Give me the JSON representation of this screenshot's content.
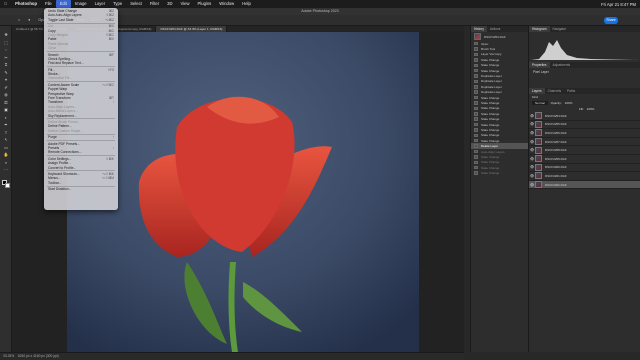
{
  "menubar": {
    "app_name": "Photoshop",
    "items": [
      "File",
      "Edit",
      "Image",
      "Layer",
      "Type",
      "Select",
      "Filter",
      "3D",
      "View",
      "Plugins",
      "Window",
      "Help"
    ],
    "active_index": 1,
    "clock": "Fri Apr 21 8:47 PM"
  },
  "window": {
    "title": "Adobe Photoshop 2023"
  },
  "options": {
    "opacity_label": "Opacity:",
    "opacity_value": "100%",
    "flow_label": "Flow:",
    "flow_value": "100%",
    "share_label": "Share"
  },
  "tabs": [
    {
      "label": "Untitled-1 @ 66.7% (Layer 1, RGB/8)"
    },
    {
      "label": "DSCF3254.RAF @ 33.3% (Background copy, RGB/16)"
    },
    {
      "label": "DSCF3254.RAF @ 33.3% (Layer 1, RGB/16)",
      "active": true
    }
  ],
  "edit_menu": {
    "rows": [
      {
        "label": "Undo State Change",
        "shortcut": "⌘Z"
      },
      {
        "label": "Auto Auto-Align Layers",
        "shortcut": "⇧⌘Z"
      },
      {
        "label": "Toggle Last State",
        "shortcut": "⌥⌘Z"
      },
      {
        "sep": true
      },
      {
        "label": "Cut",
        "shortcut": "⌘X",
        "disabled": true
      },
      {
        "label": "Copy",
        "shortcut": "⌘C"
      },
      {
        "label": "Copy Merged",
        "shortcut": "⇧⌘C",
        "disabled": true
      },
      {
        "label": "Paste",
        "shortcut": "⌘V"
      },
      {
        "label": "Paste Special",
        "shortcut": "",
        "disabled": true
      },
      {
        "label": "Clear",
        "shortcut": "",
        "disabled": true
      },
      {
        "sep": true
      },
      {
        "label": "Search",
        "shortcut": "⌘F"
      },
      {
        "label": "Check Spelling...",
        "shortcut": ""
      },
      {
        "label": "Find and Replace Text...",
        "shortcut": ""
      },
      {
        "sep": true
      },
      {
        "label": "Fill...",
        "shortcut": "⇧F5"
      },
      {
        "label": "Stroke...",
        "shortcut": ""
      },
      {
        "label": "Generative Fill...",
        "shortcut": "",
        "disabled": true
      },
      {
        "sep": true
      },
      {
        "label": "Content-Aware Scale",
        "shortcut": "⌥⇧⌘C"
      },
      {
        "label": "Puppet Warp",
        "shortcut": ""
      },
      {
        "label": "Perspective Warp",
        "shortcut": ""
      },
      {
        "label": "Free Transform",
        "shortcut": "⌘T"
      },
      {
        "label": "Transform",
        "shortcut": "›"
      },
      {
        "label": "Auto-Align Layers...",
        "shortcut": "",
        "disabled": true
      },
      {
        "label": "Auto-Blend Layers...",
        "shortcut": "",
        "disabled": true
      },
      {
        "label": "Sky Replacement...",
        "shortcut": ""
      },
      {
        "sep": true
      },
      {
        "label": "Define Brush Preset...",
        "shortcut": "",
        "disabled": true
      },
      {
        "label": "Define Pattern...",
        "shortcut": ""
      },
      {
        "label": "Define Custom Shape...",
        "shortcut": "",
        "disabled": true
      },
      {
        "sep": true
      },
      {
        "label": "Purge",
        "shortcut": "›"
      },
      {
        "sep": true
      },
      {
        "label": "Adobe PDF Presets...",
        "shortcut": ""
      },
      {
        "label": "Presets",
        "shortcut": "›"
      },
      {
        "label": "Remote Connections...",
        "shortcut": ""
      },
      {
        "sep": true
      },
      {
        "label": "Color Settings...",
        "shortcut": "⇧⌘K"
      },
      {
        "label": "Assign Profile...",
        "shortcut": ""
      },
      {
        "label": "Convert to Profile...",
        "shortcut": ""
      },
      {
        "sep": true
      },
      {
        "label": "Keyboard Shortcuts...",
        "shortcut": "⌥⇧⌘K"
      },
      {
        "label": "Menus...",
        "shortcut": "⌥⇧⌘M"
      },
      {
        "label": "Toolbar...",
        "shortcut": ""
      },
      {
        "sep": true
      },
      {
        "label": "Start Dictation...",
        "shortcut": ""
      }
    ]
  },
  "history": {
    "tab_labels": [
      "History",
      "Actions"
    ],
    "snapshot_label": "DSCF3254.RAF",
    "rows": [
      {
        "label": "Open"
      },
      {
        "label": "Brush Tool"
      },
      {
        "label": "Layer Via Copy"
      },
      {
        "label": "State Change"
      },
      {
        "label": "State Change"
      },
      {
        "label": "State Change"
      },
      {
        "label": "Duplicate Layer"
      },
      {
        "label": "Duplicate Layer"
      },
      {
        "label": "Duplicate Layer"
      },
      {
        "label": "Duplicate Layer"
      },
      {
        "label": "State Change"
      },
      {
        "label": "State Change"
      },
      {
        "label": "State Change"
      },
      {
        "label": "State Change"
      },
      {
        "label": "State Change"
      },
      {
        "label": "State Change"
      },
      {
        "label": "State Change"
      },
      {
        "label": "State Change"
      },
      {
        "label": "State Change"
      },
      {
        "label": "Delete Layer",
        "selected": true
      },
      {
        "label": "Auto-Align Layers",
        "undone": true
      },
      {
        "label": "State Change",
        "undone": true
      },
      {
        "label": "State Change",
        "undone": true
      },
      {
        "label": "State Change",
        "undone": true
      },
      {
        "label": "State Change",
        "undone": true
      }
    ]
  },
  "navigator": {
    "tab_labels": [
      "Histogram",
      "Navigator"
    ]
  },
  "properties": {
    "tab_labels": [
      "Properties",
      "Adjustments"
    ],
    "title": "Pixel Layer"
  },
  "layers": {
    "tab_labels": [
      "Layers",
      "Channels",
      "Paths"
    ],
    "kind_label": "Kind",
    "blend_mode": "Normal",
    "opacity_label": "Opacity:",
    "opacity_value": "100%",
    "fill_label": "Fill:",
    "fill_value": "100%",
    "rows": [
      {
        "name": "DSCF3254.RAF"
      },
      {
        "name": "DSCF3255.RAF"
      },
      {
        "name": "DSCF3256.RAF"
      },
      {
        "name": "DSCF3257.RAF"
      },
      {
        "name": "DSCF3258.RAF"
      },
      {
        "name": "DSCF3259.RAF"
      },
      {
        "name": "DSCF3260.RAF"
      },
      {
        "name": "DSCF3261.RAF"
      },
      {
        "name": "DSCF3262.RAF",
        "selected": true
      }
    ]
  },
  "status": {
    "zoom": "33.33%",
    "doc_info": "6240 px x 4160 px (300 ppi)"
  },
  "colors": {
    "accent": "#1473e6",
    "menu_active": "#3a66d6",
    "tulip_red": "#d03a30",
    "stem_green": "#5c9a3c"
  }
}
